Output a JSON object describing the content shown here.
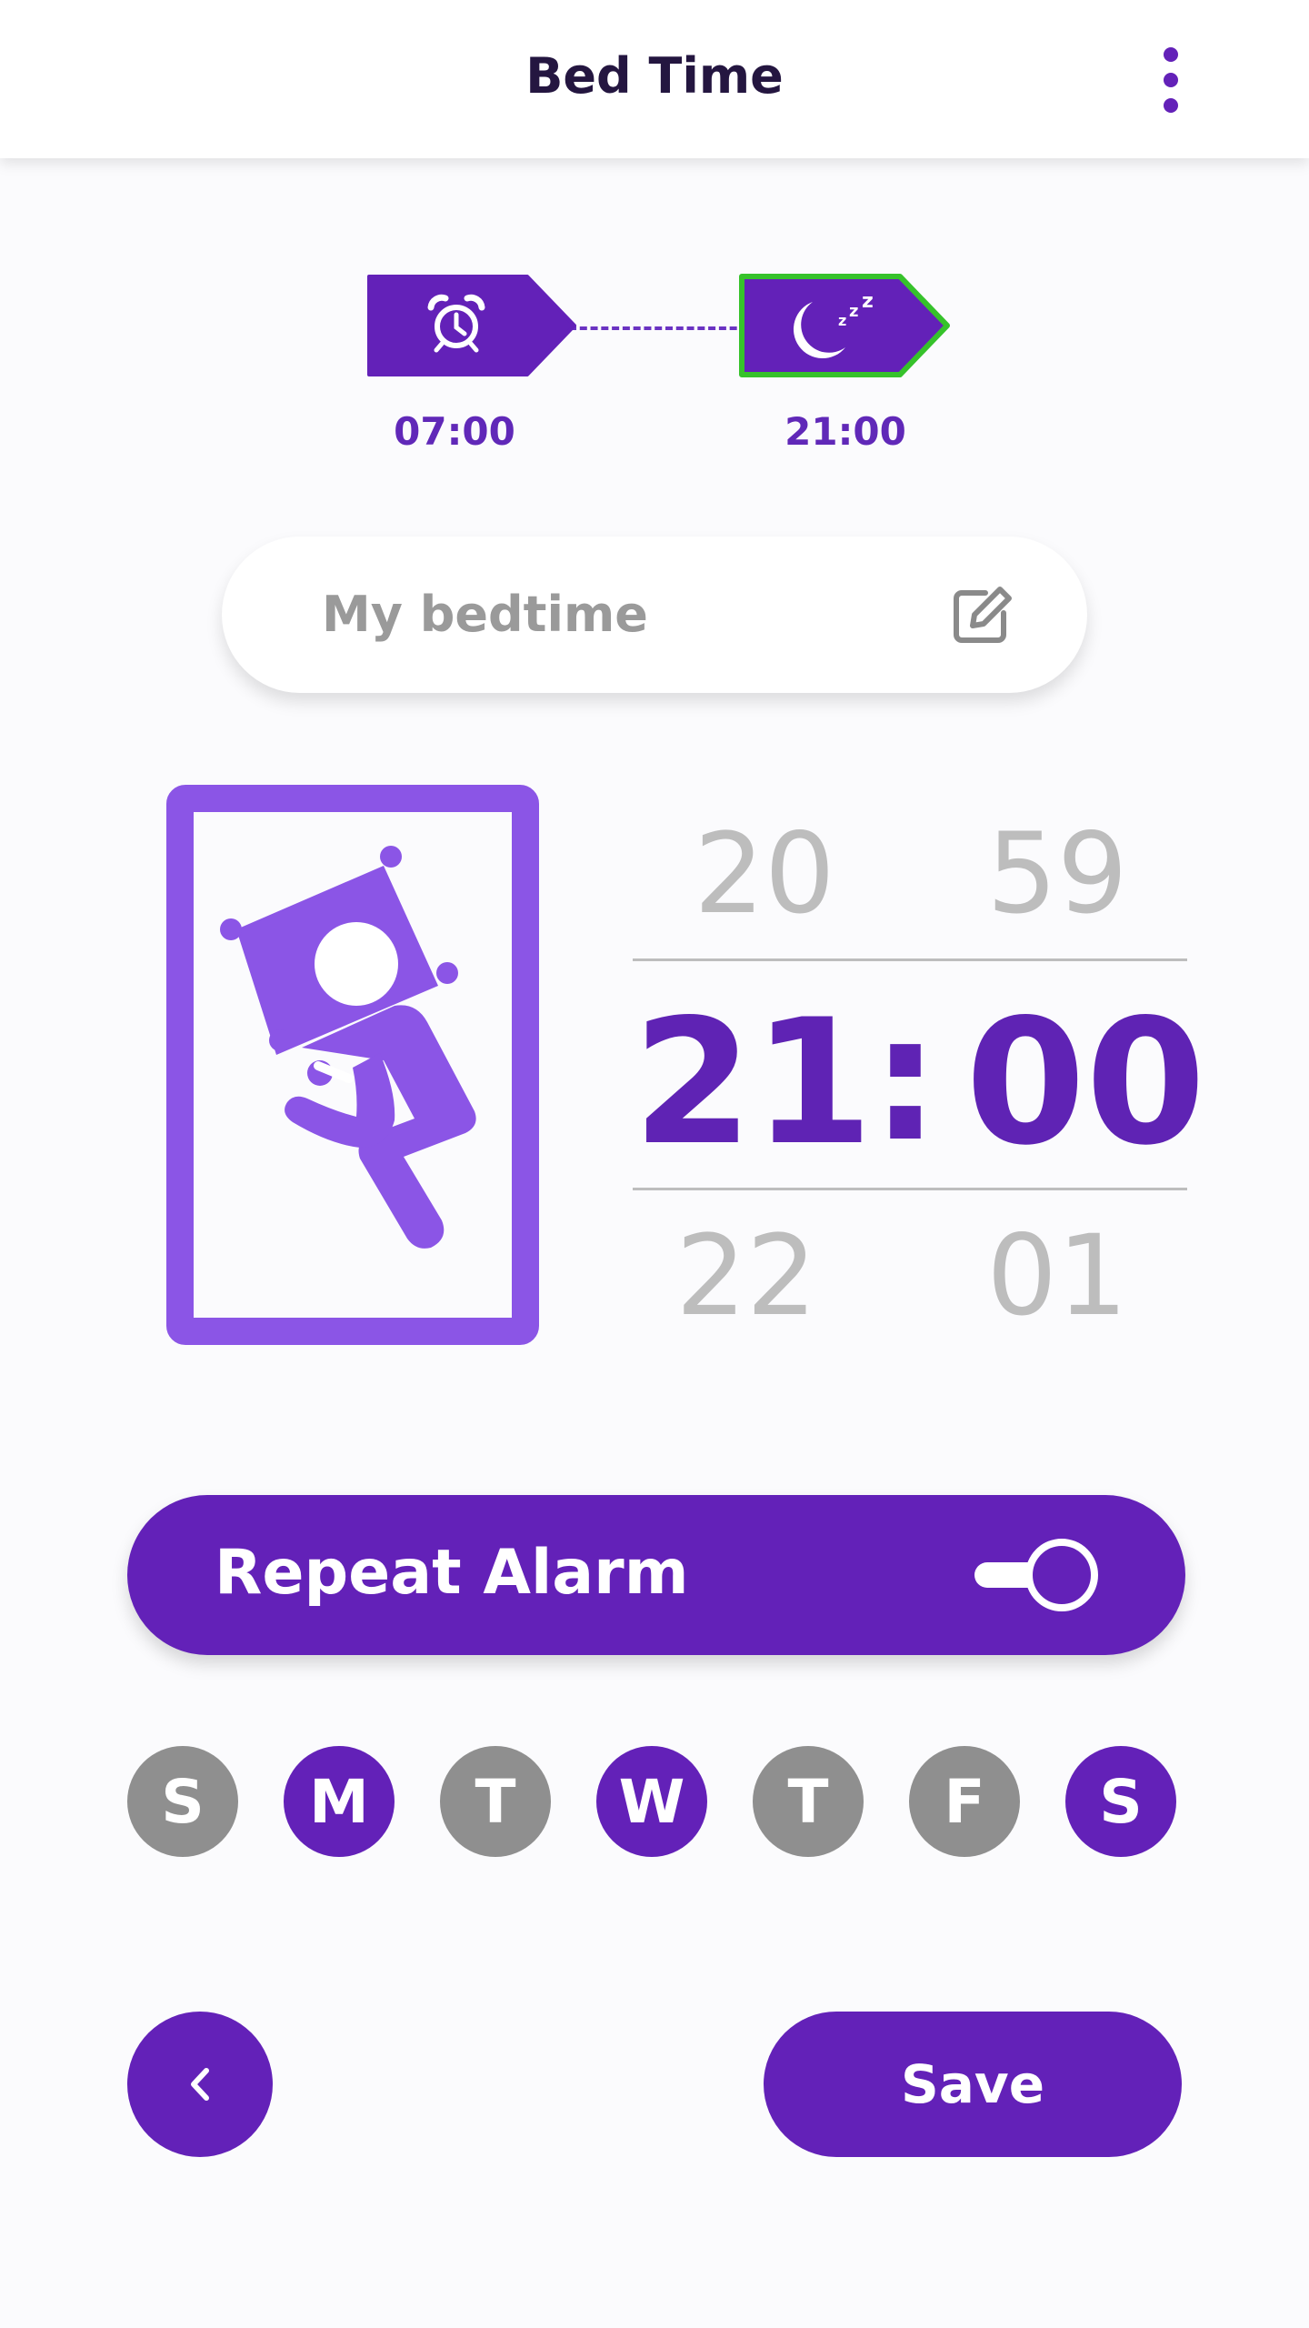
{
  "header": {
    "title": "Bed Time",
    "menu_icon": "more-vert-icon"
  },
  "stepper": {
    "steps": [
      {
        "icon": "alarm-clock-icon",
        "time": "07:00",
        "active": false
      },
      {
        "icon": "moon-sleep-icon",
        "time": "21:00",
        "active": true
      }
    ],
    "active_border_color": "#36c22b"
  },
  "label_field": {
    "value": "My bedtime",
    "icon": "edit-icon"
  },
  "illustration": {
    "icon": "sleeping-person-icon"
  },
  "time_picker": {
    "hours": {
      "prev": "20",
      "current": "21",
      "next": "22"
    },
    "minutes": {
      "prev": "59",
      "current": "00",
      "next": "01"
    },
    "separator": ":"
  },
  "repeat": {
    "label": "Repeat Alarm",
    "enabled": true
  },
  "days": [
    {
      "label": "S",
      "selected": false
    },
    {
      "label": "M",
      "selected": true
    },
    {
      "label": "T",
      "selected": false
    },
    {
      "label": "W",
      "selected": true
    },
    {
      "label": "T",
      "selected": false
    },
    {
      "label": "F",
      "selected": false
    },
    {
      "label": "S",
      "selected": true
    }
  ],
  "footer": {
    "back_icon": "chevron-left-icon",
    "save_label": "Save"
  },
  "colors": {
    "primary": "#6321b8",
    "illustration": "#8b55e6",
    "inactive_day": "#8f8f8f"
  }
}
